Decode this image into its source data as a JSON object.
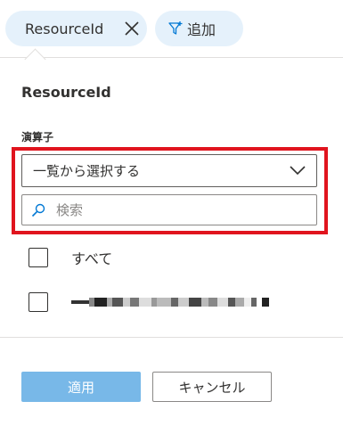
{
  "filter_chips": {
    "resource_chip_label": "ResourceId",
    "add_chip_label": "追加"
  },
  "panel": {
    "title": "ResourceId",
    "operator_label": "演算子",
    "operator_selected": "一覧から選択する",
    "search_placeholder": "検索",
    "options": {
      "all_label": "すべて",
      "item_label": "●●●●●●●●●●●●●●●●●●●●●"
    }
  },
  "buttons": {
    "apply_label": "適用",
    "cancel_label": "キャンセル"
  },
  "colors": {
    "chip_bg": "#e5f1fb",
    "accent_icon": "#0078d4",
    "highlight_box": "#e0141e",
    "apply_disabled": "#78b8e8"
  }
}
